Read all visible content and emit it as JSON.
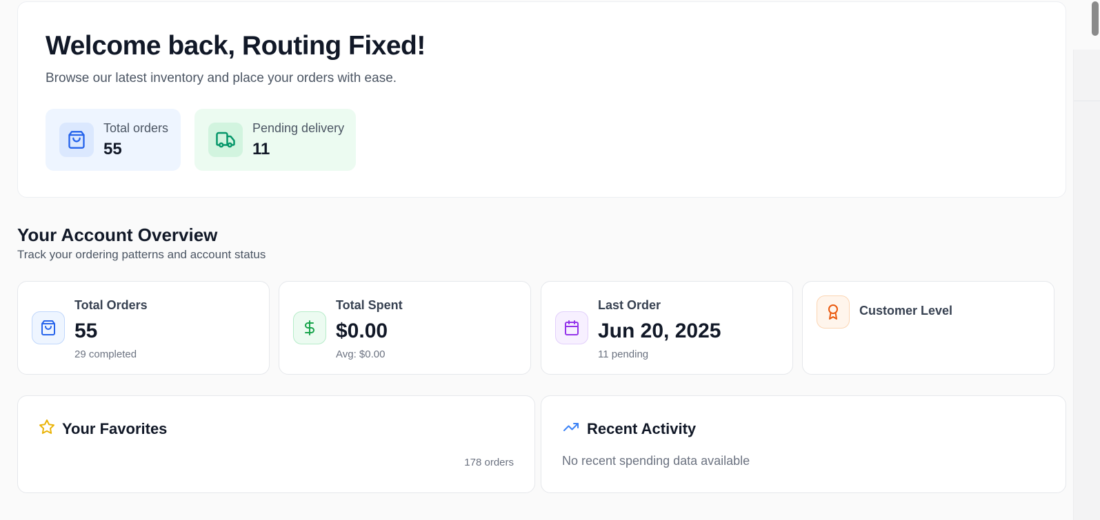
{
  "welcome": {
    "title": "Welcome back, Routing Fixed!",
    "subtitle": "Browse our latest inventory and place your orders with ease.",
    "stats": [
      {
        "label": "Total orders",
        "value": "55",
        "icon": "shopping-bag-icon",
        "color": "#2563eb"
      },
      {
        "label": "Pending delivery",
        "value": "11",
        "icon": "truck-icon",
        "color": "#059669"
      }
    ]
  },
  "overview": {
    "title": "Your Account Overview",
    "subtitle": "Track your ordering patterns and account status",
    "cards": [
      {
        "label": "Total Orders",
        "value": "55",
        "footer": "29 completed",
        "icon": "shopping-bag-icon",
        "color": "#2563eb"
      },
      {
        "label": "Total Spent",
        "value": "$0.00",
        "footer": "Avg: $0.00",
        "icon": "dollar-icon",
        "color": "#16a34a"
      },
      {
        "label": "Last Order",
        "value": "Jun 20, 2025",
        "footer": "11 pending",
        "icon": "calendar-icon",
        "color": "#9333ea"
      },
      {
        "label": "Customer Level",
        "icon": "award-icon",
        "color": "#ea580c"
      }
    ]
  },
  "favorites": {
    "title": "Your Favorites",
    "count": "178 orders",
    "icon": "star-icon",
    "color": "#eab308"
  },
  "activity": {
    "title": "Recent Activity",
    "empty_text": "No recent spending data available",
    "icon": "trending-up-icon",
    "color": "#3b82f6"
  }
}
